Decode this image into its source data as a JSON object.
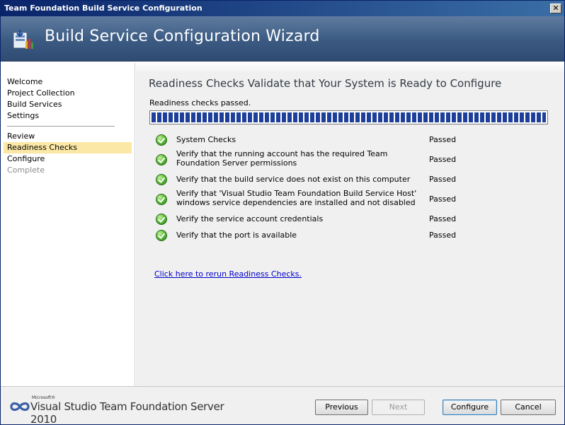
{
  "window": {
    "title": "Team Foundation Build Service Configuration",
    "close_glyph": "✕"
  },
  "banner": {
    "title": "Build Service Configuration Wizard"
  },
  "sidebar": {
    "group1": [
      {
        "label": "Welcome"
      },
      {
        "label": "Project Collection"
      },
      {
        "label": "Build Services"
      },
      {
        "label": "Settings"
      }
    ],
    "group2": [
      {
        "label": "Review"
      },
      {
        "label": "Readiness Checks"
      },
      {
        "label": "Configure"
      },
      {
        "label": "Complete"
      }
    ]
  },
  "main": {
    "heading": "Readiness Checks Validate that Your System is Ready to Configure",
    "status": "Readiness checks passed.",
    "progress": 1.0,
    "checks": [
      {
        "text": "System Checks",
        "result": "Passed"
      },
      {
        "text": "Verify that the running account has the required Team Foundation Server permissions",
        "result": "Passed"
      },
      {
        "text": "Verify that the build service does not exist on this computer",
        "result": "Passed"
      },
      {
        "text": "Verify that 'Visual Studio Team Foundation Build Service Host' windows service dependencies are installed and not disabled",
        "result": "Passed"
      },
      {
        "text": "Verify the service account credentials",
        "result": "Passed"
      },
      {
        "text": "Verify that the port is available",
        "result": "Passed"
      }
    ],
    "rerun_link": "Click here to rerun Readiness Checks."
  },
  "footer": {
    "logo_microsoft": "Microsoft®",
    "logo_text": "Visual Studio Team Foundation Server 2010",
    "buttons": {
      "previous": "Previous",
      "next": "Next",
      "configure": "Configure",
      "cancel": "Cancel"
    }
  },
  "colors": {
    "active_nav": "#fbe8a6",
    "progress_fill": "#1d3f9a",
    "check_green": "#5fbe3a",
    "link": "#0000cc"
  },
  "icons": {
    "banner": "wizard-icon",
    "check": "check-passed-icon",
    "logo": "infinity-logo-icon"
  }
}
